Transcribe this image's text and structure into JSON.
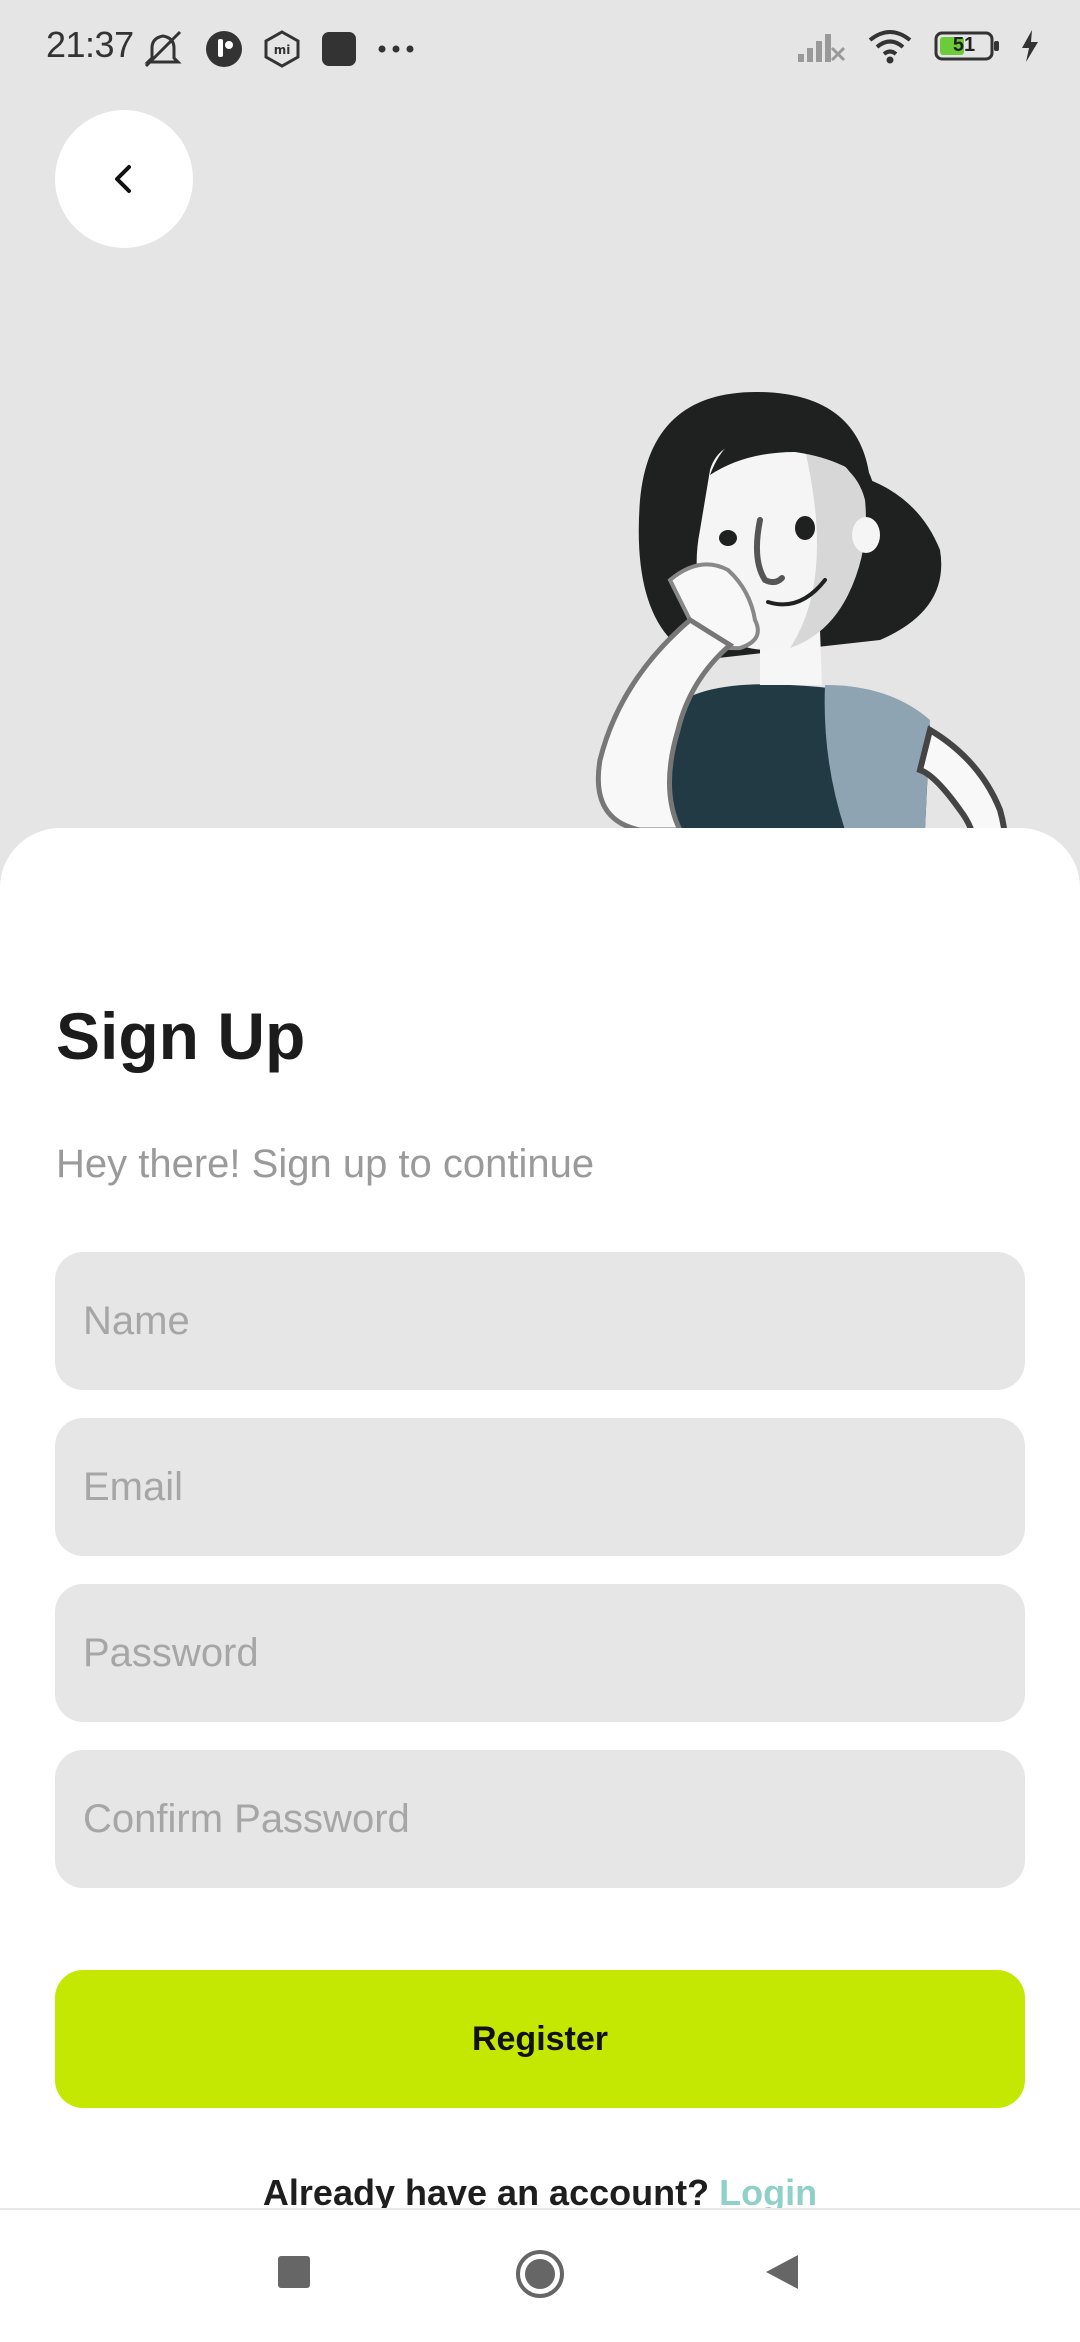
{
  "status_bar": {
    "time": "21:37",
    "left_icons": [
      "mute-icon",
      "app-icon",
      "mi-icon",
      "square-app-icon",
      "more-dots-icon"
    ],
    "right_icons": [
      "signal-icon",
      "wifi-icon",
      "battery-icon",
      "charging-icon"
    ],
    "battery_level": "51"
  },
  "back_button": {
    "icon": "chevron-left-icon"
  },
  "form": {
    "title": "Sign Up",
    "subtitle": "Hey there! Sign up to continue",
    "name_placeholder": "Name",
    "email_placeholder": "Email",
    "password_placeholder": "Password",
    "confirm_password_placeholder": "Confirm Password",
    "register_label": "Register",
    "login_prompt": "Already have an account?",
    "login_link": "Login"
  },
  "colors": {
    "accent": "#c5e803",
    "link": "#8fd0c8",
    "background": "#e5e5e5",
    "field": "#e6e6e6"
  },
  "nav_bar": {
    "buttons": [
      "recents-square-icon",
      "home-circle-icon",
      "back-triangle-icon"
    ]
  }
}
